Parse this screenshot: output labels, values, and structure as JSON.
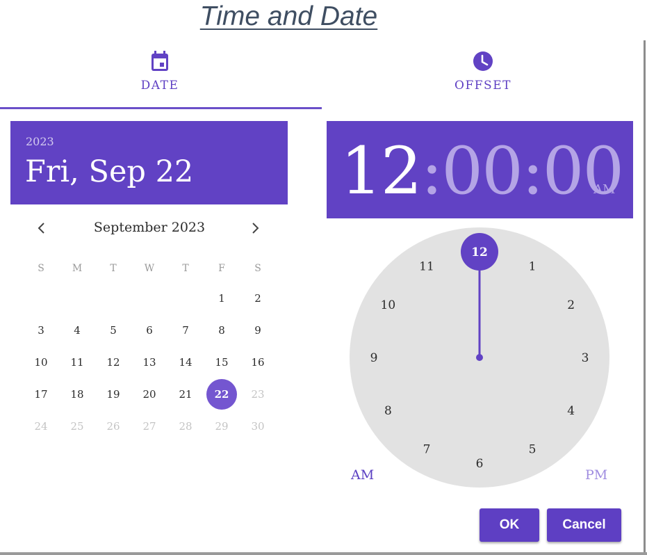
{
  "page": {
    "title": "Time and Date"
  },
  "tabs": [
    {
      "label": "DATE",
      "icon": "calendar-icon",
      "active": true
    },
    {
      "label": "OFFSET",
      "icon": "clock-icon",
      "active": false
    }
  ],
  "date_header": {
    "year": "2023",
    "display": "Fri, Sep 22"
  },
  "calendar": {
    "month_label": "September 2023",
    "weekdays": [
      "S",
      "M",
      "T",
      "W",
      "T",
      "F",
      "S"
    ],
    "weeks": [
      [
        "",
        "",
        "",
        "",
        "",
        "1",
        "2"
      ],
      [
        "3",
        "4",
        "5",
        "6",
        "7",
        "8",
        "9"
      ],
      [
        "10",
        "11",
        "12",
        "13",
        "14",
        "15",
        "16"
      ],
      [
        "17",
        "18",
        "19",
        "20",
        "21",
        "22",
        "23"
      ],
      [
        "24",
        "25",
        "26",
        "27",
        "28",
        "29",
        "30"
      ]
    ],
    "selected_day": "22",
    "disabled_days": [
      "23",
      "24",
      "25",
      "26",
      "27",
      "28",
      "29",
      "30"
    ]
  },
  "time_header": {
    "hour": "12",
    "rest": ":00:00",
    "ampm": "AM"
  },
  "clock": {
    "numbers": [
      "12",
      "1",
      "2",
      "3",
      "4",
      "5",
      "6",
      "7",
      "8",
      "9",
      "10",
      "11"
    ],
    "selected": "12",
    "am_label": "AM",
    "pm_label": "PM"
  },
  "buttons": {
    "ok": "OK",
    "cancel": "Cancel"
  },
  "colors": {
    "accent": "#6142c4",
    "selected": "#7456d0",
    "clock_face": "#e2e2e2"
  }
}
